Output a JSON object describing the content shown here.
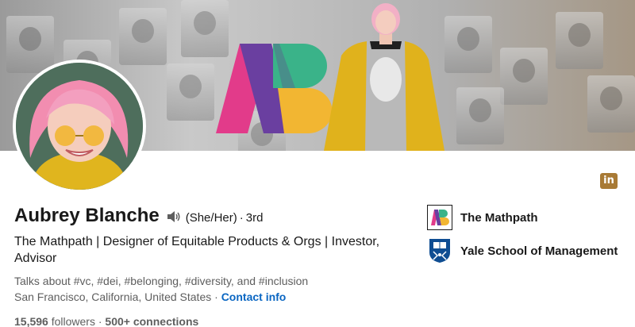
{
  "profile": {
    "name": "Aubrey Blanche",
    "pronouns": "(She/Her)",
    "separator": "·",
    "degree": "3rd",
    "headline": "The Mathpath | Designer of Equitable Products & Orgs | Investor, Advisor",
    "talks_about": "Talks about #vc, #dei, #belonging, #diversity, and #inclusion",
    "location": "San Francisco, California, United States",
    "contact_info": "Contact info",
    "followers_count": "15,596",
    "followers_label": "followers",
    "connections": "500+ connections"
  },
  "orgs": [
    {
      "name": "The Mathpath",
      "logo": "mathpath-logo"
    },
    {
      "name": "Yale School of Management",
      "logo": "yale-shield-logo"
    }
  ],
  "badges": {
    "linkedin_badge": "in"
  },
  "colors": {
    "link": "#0a66c2",
    "badge": "#a87a35",
    "logo_pink": "#e23b8a",
    "logo_purple": "#6a3fa0",
    "logo_green": "#3ab389",
    "logo_yellow": "#f2b632",
    "yale_blue": "#0f4d92"
  },
  "icons": {
    "speaker": "speaker-icon"
  }
}
